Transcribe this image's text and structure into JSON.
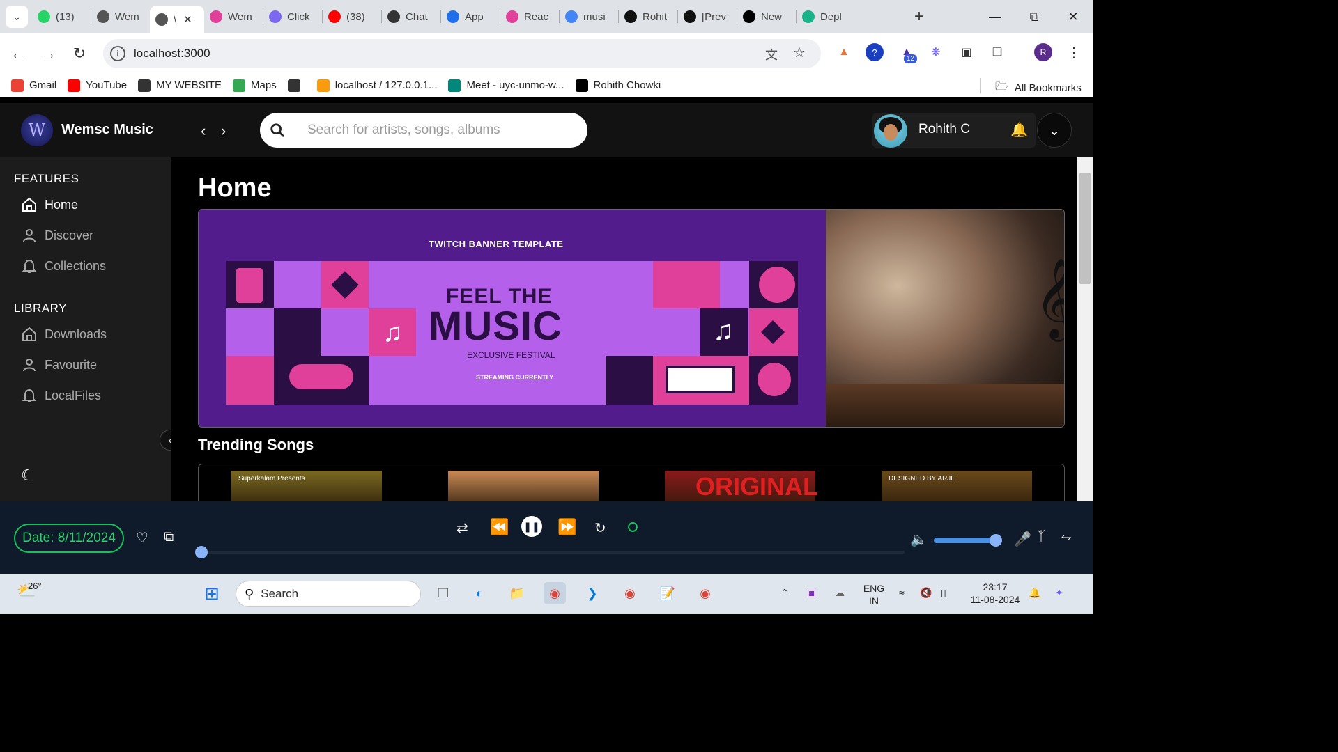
{
  "browser": {
    "tabs": [
      {
        "label": "(13)",
        "fav_color": "#25d366",
        "icon": "whatsapp-icon"
      },
      {
        "label": "Wem",
        "fav_color": "#555555",
        "icon": "globe-icon"
      },
      {
        "label": "\\",
        "fav_color": "#555555",
        "icon": "globe-icon",
        "active": true
      },
      {
        "label": "Wem",
        "fav_color": "#e0409a",
        "icon": "wemsc-icon"
      },
      {
        "label": "Click",
        "fav_color": "#7b68ee",
        "icon": "clickup-icon"
      },
      {
        "label": "(38)",
        "fav_color": "#ff0000",
        "icon": "youtube-icon"
      },
      {
        "label": "Chat",
        "fav_color": "#333333",
        "icon": "chatgpt-icon"
      },
      {
        "label": "App",
        "fav_color": "#1f6feb",
        "icon": "app-icon"
      },
      {
        "label": "Reac",
        "fav_color": "#e0409a",
        "icon": "react-icon"
      },
      {
        "label": "musi",
        "fav_color": "#4285f4",
        "icon": "google-icon"
      },
      {
        "label": "Rohit",
        "fav_color": "#111111",
        "icon": "github-icon"
      },
      {
        "label": "[Prev",
        "fav_color": "#111111",
        "icon": "github-icon"
      },
      {
        "label": "New",
        "fav_color": "#000000",
        "icon": "vercel-icon"
      },
      {
        "label": "Depl",
        "fav_color": "#19b38a",
        "icon": "deploy-icon"
      }
    ],
    "url": "localhost:3000",
    "bookmarks": [
      {
        "label": "Gmail",
        "color": "#ea4335",
        "icon": "gmail-icon"
      },
      {
        "label": "YouTube",
        "color": "#ff0000",
        "icon": "youtube-icon"
      },
      {
        "label": "MY WEBSITE",
        "color": "#333333",
        "icon": "globe-icon"
      },
      {
        "label": "Maps",
        "color": "#34a853",
        "icon": "maps-icon"
      },
      {
        "label": "",
        "color": "#333333",
        "icon": "globe-icon"
      },
      {
        "label": "localhost / 127.0.0.1...",
        "color": "#f89c0e",
        "icon": "phpmyadmin-icon"
      },
      {
        "label": "Meet - uyc-unmo-w...",
        "color": "#00897b",
        "icon": "meet-icon"
      },
      {
        "label": "Rohith Chowki",
        "color": "#000000",
        "icon": "vercel-icon"
      }
    ],
    "all_bookmarks": "All Bookmarks",
    "profile_initial": "R",
    "ext_badge": "12"
  },
  "app": {
    "name": "Wemsc  Music",
    "logo_letter": "W",
    "search_placeholder": "Search for artists, songs, albums",
    "user_name": "Rohith C",
    "sidebar": {
      "features_title": "FEATURES",
      "features": [
        {
          "label": "Home",
          "active": true,
          "icon": "home-icon"
        },
        {
          "label": "Discover",
          "active": false,
          "icon": "user-icon"
        },
        {
          "label": "Collections",
          "active": false,
          "icon": "bell-icon"
        }
      ],
      "library_title": "LIBRARY",
      "library": [
        {
          "label": "Downloads",
          "icon": "home-icon"
        },
        {
          "label": "Favourite",
          "icon": "user-icon"
        },
        {
          "label": "LocalFiles",
          "icon": "bell-icon"
        }
      ]
    },
    "page_title": "Home",
    "banner": {
      "top": "TWITCH BANNER TEMPLATE",
      "feel": "FEEL THE",
      "music": "MUSIC",
      "sub": "EXCLUSIVE FESTIVAL",
      "stream": "STREAMING CURRENTLY"
    },
    "trending_title": "Trending Songs",
    "trending": [
      {
        "caption": "Superkalam Presents",
        "color": "#7a6a20"
      },
      {
        "caption": "",
        "color": "#c98a55"
      },
      {
        "caption": "ORIGINAL",
        "color": "#8a1a1a"
      },
      {
        "caption": "DESIGNED BY ARJE",
        "color": "#6a4a1a"
      }
    ],
    "player": {
      "date_text": "Date: 8/11/2024",
      "progress": 0.0,
      "volume": 0.9
    }
  },
  "taskbar": {
    "weather": "26°",
    "search_label": "Search",
    "lang1": "ENG",
    "lang2": "IN",
    "time": "23:17",
    "date": "11-08-2024"
  }
}
